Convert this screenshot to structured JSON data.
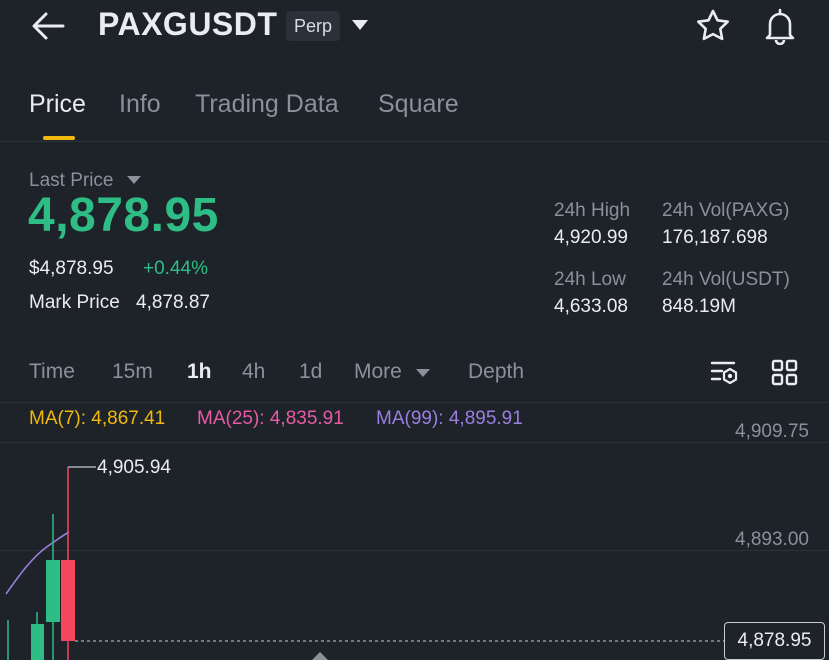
{
  "header": {
    "title": "PAXGUSDT",
    "badge": "Perp"
  },
  "tabs": [
    {
      "label": "Price",
      "active": true
    },
    {
      "label": "Info",
      "active": false
    },
    {
      "label": "Trading Data",
      "active": false
    },
    {
      "label": "Square",
      "active": false
    }
  ],
  "price": {
    "last_price_label": "Last Price",
    "last_price": "4,878.95",
    "usd_price": "$4,878.95",
    "change": "+0.44%",
    "mark_label": "Mark Price",
    "mark_value": "4,878.87"
  },
  "stats": {
    "high_label": "24h High",
    "high_value": "4,920.99",
    "vol_paxg_label": "24h Vol(PAXG)",
    "vol_paxg_value": "176,187.698",
    "low_label": "24h Low",
    "low_value": "4,633.08",
    "vol_usdt_label": "24h Vol(USDT)",
    "vol_usdt_value": "848.19M"
  },
  "timeframes": [
    {
      "label": "Time",
      "active": false
    },
    {
      "label": "15m",
      "active": false
    },
    {
      "label": "1h",
      "active": true
    },
    {
      "label": "4h",
      "active": false
    },
    {
      "label": "1d",
      "active": false
    },
    {
      "label": "More",
      "active": false
    },
    {
      "label": "Depth",
      "active": false
    }
  ],
  "ma": {
    "ma7": "MA(7): 4,867.41",
    "ma25": "MA(25): 4,835.91",
    "ma99": "MA(99): 4,895.91"
  },
  "chart": {
    "axis_top": "4,909.75",
    "axis_mid": "4,893.00",
    "current": "4,878.95",
    "high_marker": "4,905.94"
  },
  "colors": {
    "up": "#2ebd85",
    "down": "#f6465d",
    "accent": "#f0b90b",
    "ma7": "#f0b90b",
    "ma25": "#e85ba6",
    "ma99": "#9b7fe0",
    "bg": "#1e2229"
  }
}
